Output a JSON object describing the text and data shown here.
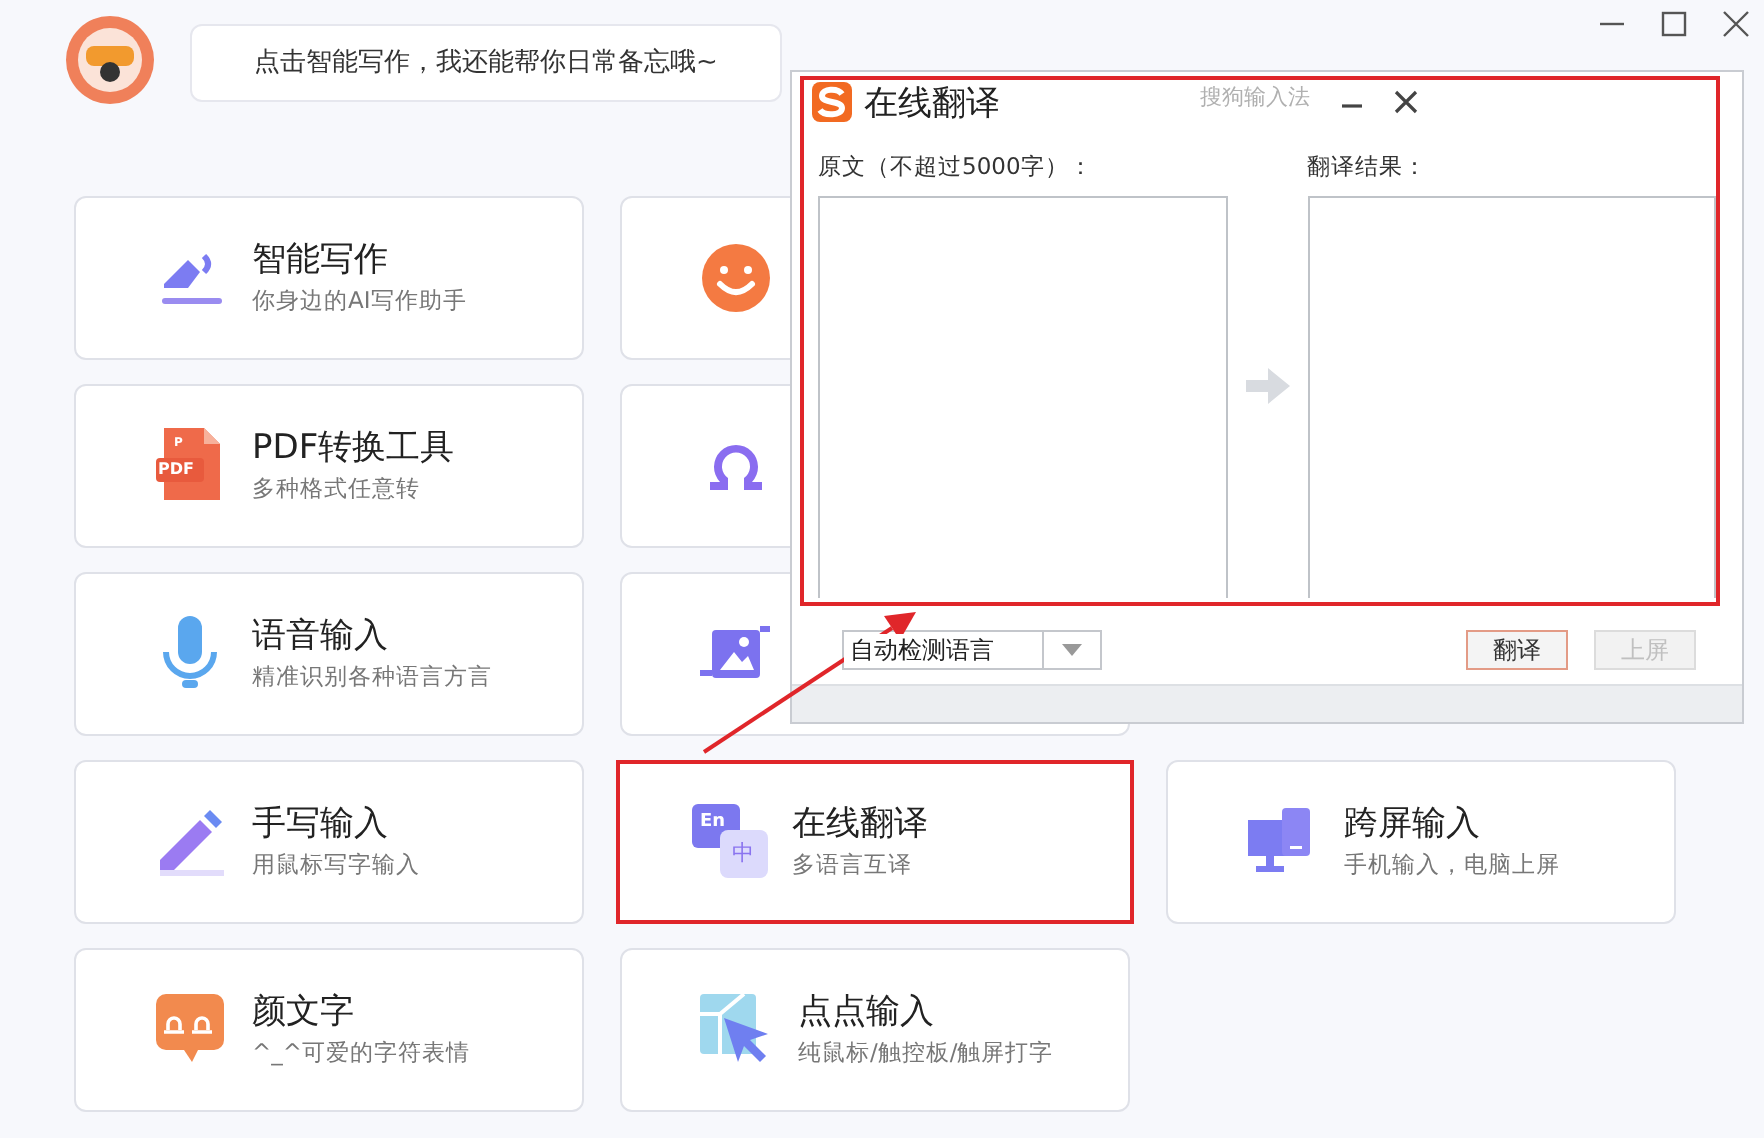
{
  "window": {
    "controls": [
      {
        "kind": "minimize"
      },
      {
        "kind": "maximize"
      },
      {
        "kind": "close"
      }
    ]
  },
  "assistant": {
    "message": "点击智能写作，我还能帮你日常备忘哦~"
  },
  "rows": [
    {
      "cards": [
        {
          "kind": "pen",
          "title": "智能写作",
          "subtitle": "你身边的AI写作助手",
          "highlighted": false
        },
        {
          "kind": "smiley",
          "highlighted": false
        }
      ]
    },
    {
      "cards": [
        {
          "kind": "pdf",
          "icon_labels": [
            "P",
            "PDF"
          ],
          "title": "PDF转换工具",
          "subtitle": "多种格式任意转",
          "highlighted": false
        },
        {
          "kind": "omega",
          "highlighted": false
        }
      ]
    },
    {
      "cards": [
        {
          "kind": "mic",
          "title": "语音输入",
          "subtitle": "精准识别各种语言方言",
          "highlighted": false
        },
        {
          "kind": "crop",
          "highlighted": false
        }
      ]
    },
    {
      "cards": [
        {
          "kind": "handwrite",
          "title": "手写输入",
          "subtitle": "用鼠标写字输入",
          "highlighted": false
        },
        {
          "kind": "translate",
          "icon_labels": [
            "En",
            "中"
          ],
          "title": "在线翻译",
          "subtitle": "多语言互译",
          "highlighted": true
        },
        {
          "kind": "screens",
          "title": "跨屏输入",
          "subtitle": "手机输入，电脑上屏",
          "highlighted": false
        }
      ]
    },
    {
      "cards": [
        {
          "kind": "kaomoji",
          "title": "颜文字",
          "subtitle": "^_^可爱的字符表情",
          "highlighted": false
        },
        {
          "kind": "pointer",
          "title": "点点输入",
          "subtitle": "纯鼠标/触控板/触屏打字",
          "highlighted": false
        }
      ]
    }
  ],
  "popup": {
    "title": "在线翻译",
    "brand": "搜狗输入法",
    "highlighted": true,
    "source_label": "原文（不超过5000字）：",
    "result_label": "翻译结果：",
    "language": "自动检测语言",
    "buttons": [
      {
        "label": "翻译",
        "disabled": false
      },
      {
        "label": "上屏",
        "disabled": true
      }
    ]
  }
}
